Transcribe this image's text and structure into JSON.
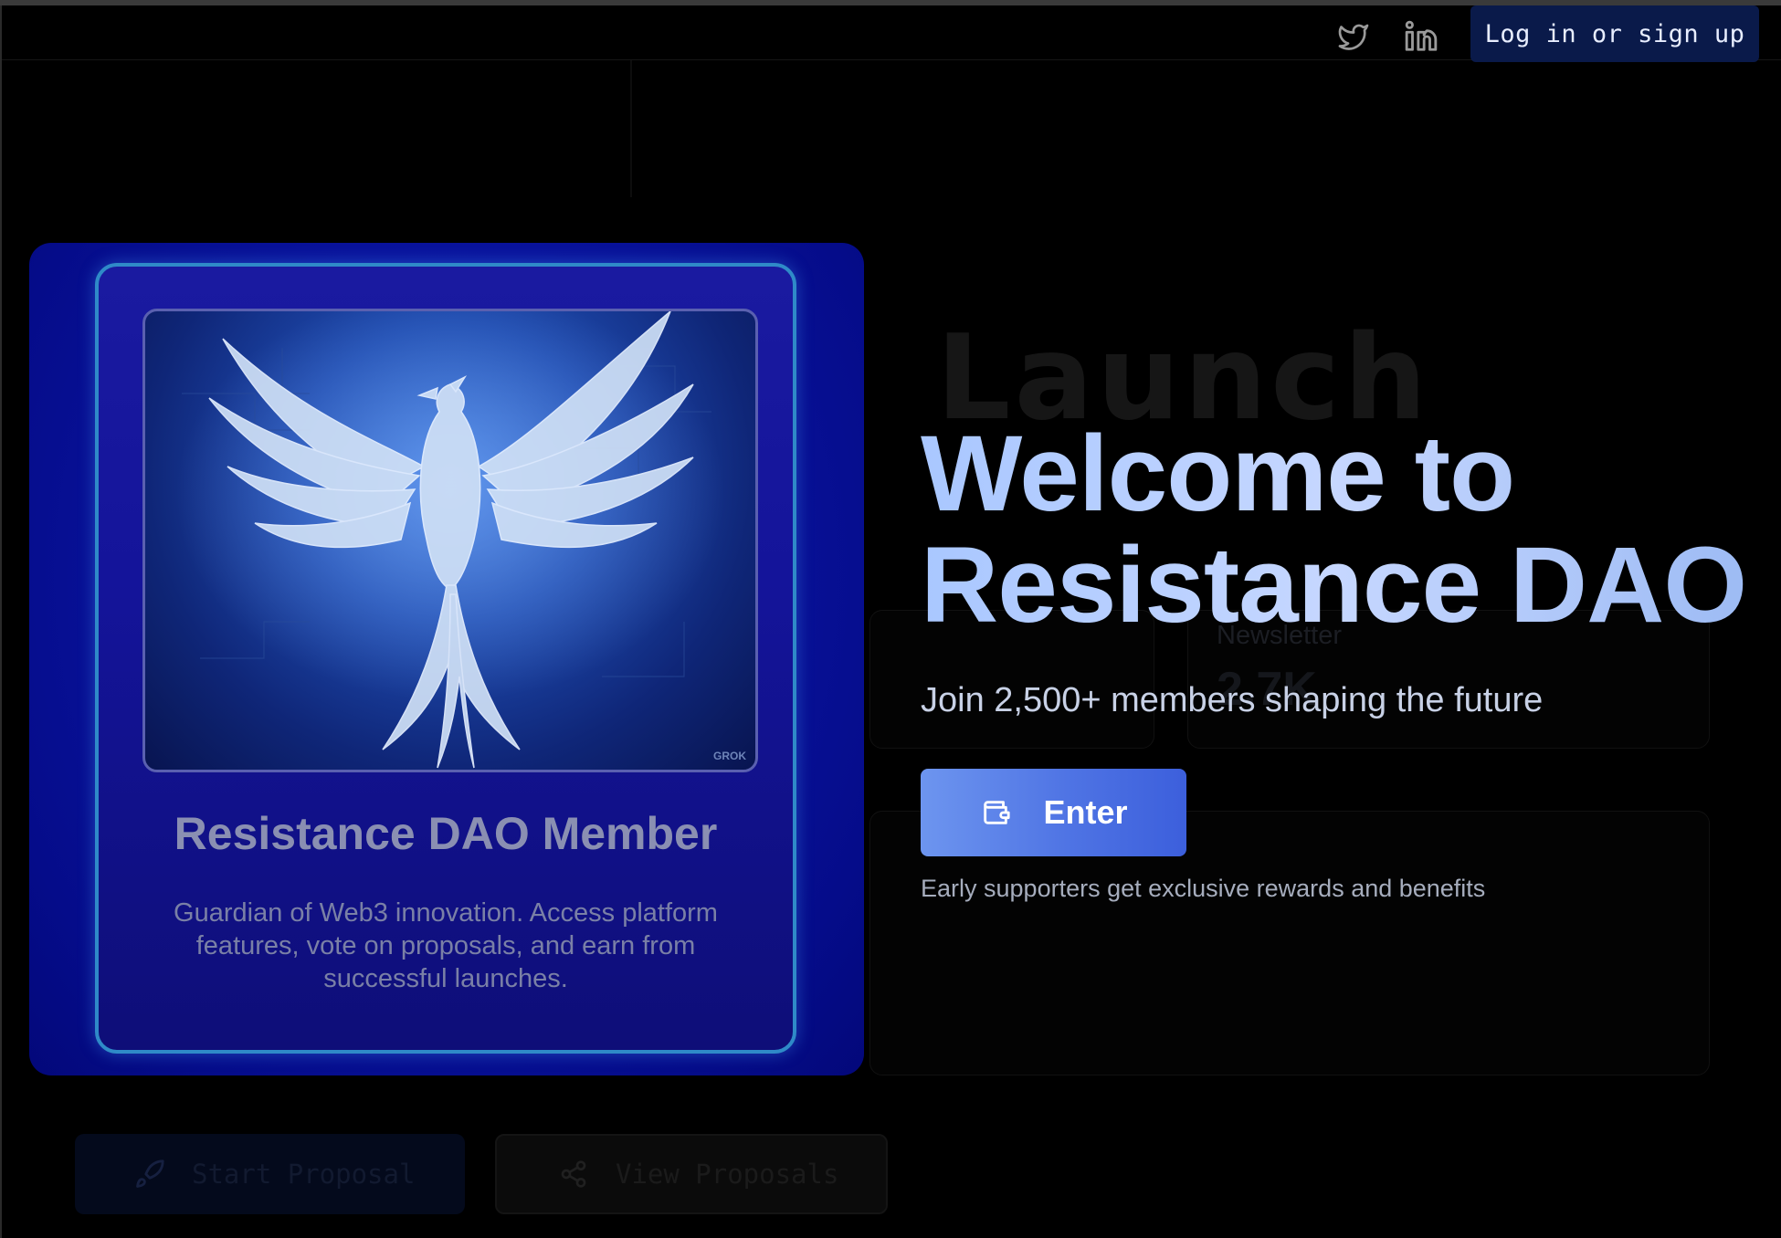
{
  "header": {
    "login_label": "Log in or sign up",
    "icons": [
      "twitter-icon",
      "linkedin-icon"
    ]
  },
  "background": {
    "launch_word": "Launch",
    "newsletter_label": "Newsletter",
    "newsletter_value": "2.7K",
    "start_proposal_label": "Start Proposal",
    "view_proposals_label": "View Proposals"
  },
  "member_card": {
    "title": "Resistance DAO Member",
    "description": "Guardian of Web3 innovation. Access platform features, vote on proposals, and earn from successful launches.",
    "image_watermark": "GROK"
  },
  "hero": {
    "title_line1": "Welcome to",
    "title_line2": "Resistance DAO",
    "subtitle": "Join 2,500+ members shaping the future",
    "enter_label": "Enter",
    "note": "Early supporters get exclusive rewards and benefits"
  },
  "colors": {
    "accent": "#4f74e4",
    "card_bg": "#0a14a0",
    "frame_border": "#2f8ac8",
    "login_bg": "#0a1a4a"
  }
}
